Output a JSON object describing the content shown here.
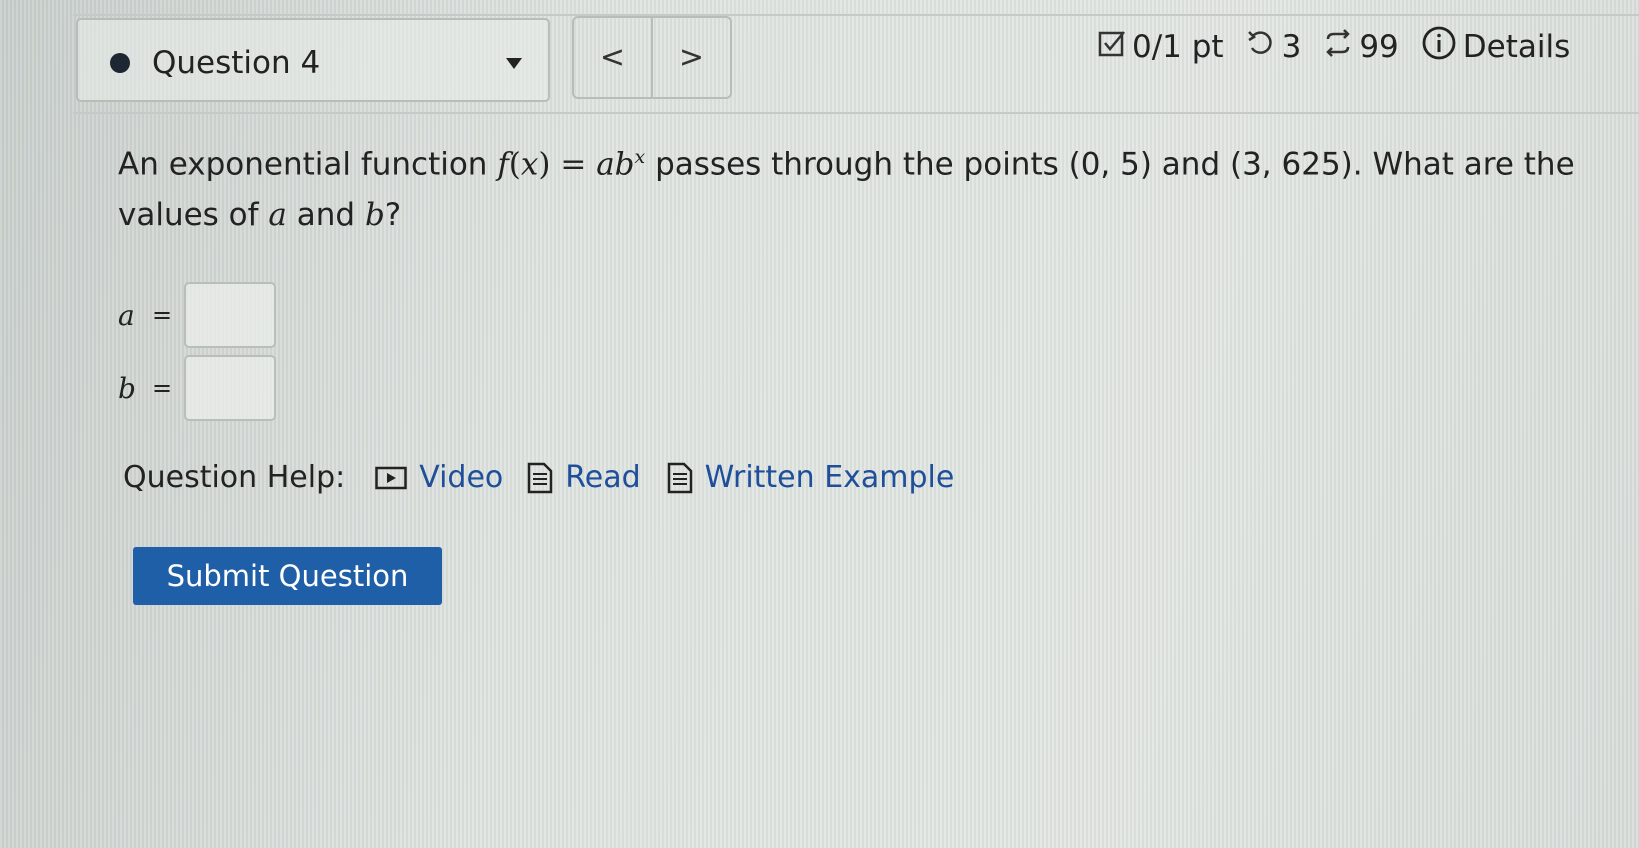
{
  "header": {
    "question_label": "Question 4",
    "prev_label": "<",
    "next_label": ">",
    "score": "0/1 pt",
    "retries": "3",
    "attempts": "99",
    "details_label": "Details"
  },
  "question": {
    "intro": "An exponential function ",
    "f": "f",
    "lp": "(",
    "x": "x",
    "rp": ")",
    "eqs": " = ",
    "a": "a",
    "b": "b",
    "exp": "x",
    "mid": " passes through the points (0, 5) and (3, 625). What are the values of ",
    "a2": "a",
    "and": " and ",
    "b2": "b",
    "end": "?"
  },
  "answers": [
    {
      "var": "a",
      "eq": "=",
      "value": ""
    },
    {
      "var": "b",
      "eq": "=",
      "value": ""
    }
  ],
  "help": {
    "label": "Question Help:",
    "video": "Video",
    "read": "Read",
    "written": "Written Example"
  },
  "submit_label": "Submit Question",
  "colors": {
    "link": "#1f4f9a",
    "submit_bg": "#1f5fa8",
    "background": "#dde2df"
  },
  "icons": [
    "status-dot-icon",
    "dropdown-caret-icon",
    "checkbox-icon",
    "retry-icon",
    "attempts-icon",
    "info-icon",
    "video-icon",
    "document-icon"
  ]
}
